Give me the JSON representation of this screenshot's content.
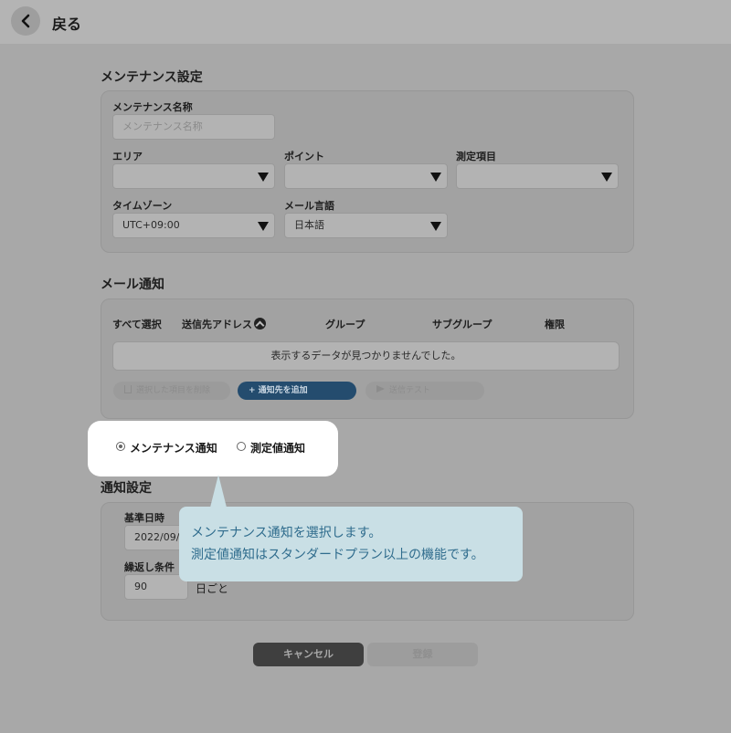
{
  "header": {
    "back_label": "戻る"
  },
  "maintenance": {
    "title": "メンテナンス設定",
    "name_label": "メンテナンス名称",
    "name_placeholder": "メンテナンス名称",
    "area_label": "エリア",
    "point_label": "ポイント",
    "measure_label": "測定項目",
    "timezone_label": "タイムゾーン",
    "timezone_value": "UTC+09:00",
    "mail_lang_label": "メール言語",
    "mail_lang_value": "日本語"
  },
  "mail": {
    "title": "メール通知",
    "columns": {
      "select_all": "すべて選択",
      "address": "送信先アドレス",
      "group": "グループ",
      "subgroup": "サブグループ",
      "permission": "権限"
    },
    "empty_message": "表示するデータが見つかりませんでした。",
    "delete_label": "選択した項目を削除",
    "add_label": "+ 通知先を追加",
    "test_label": "送信テスト"
  },
  "notify_type": {
    "options": [
      {
        "label": "メンテナンス通知",
        "checked": true
      },
      {
        "label": "測定値通知",
        "checked": false
      }
    ]
  },
  "tooltip": {
    "line1": "メンテナンス通知を選択します。",
    "line2": "測定値通知はスタンダードプラン以上の機能です。"
  },
  "notify_settings": {
    "title": "通知設定",
    "base_datetime_label": "基準日時",
    "base_datetime_value": "2022/09/",
    "repeat_label": "繰返し条件",
    "repeat_value": "90",
    "repeat_unit": "日ごと"
  },
  "footer": {
    "cancel_label": "キャンセル",
    "submit_label": "登録"
  },
  "colors": {
    "primary": "#244c6e",
    "tooltip_bg": "#c9dfe5",
    "tooltip_text": "#2f6c8d"
  }
}
